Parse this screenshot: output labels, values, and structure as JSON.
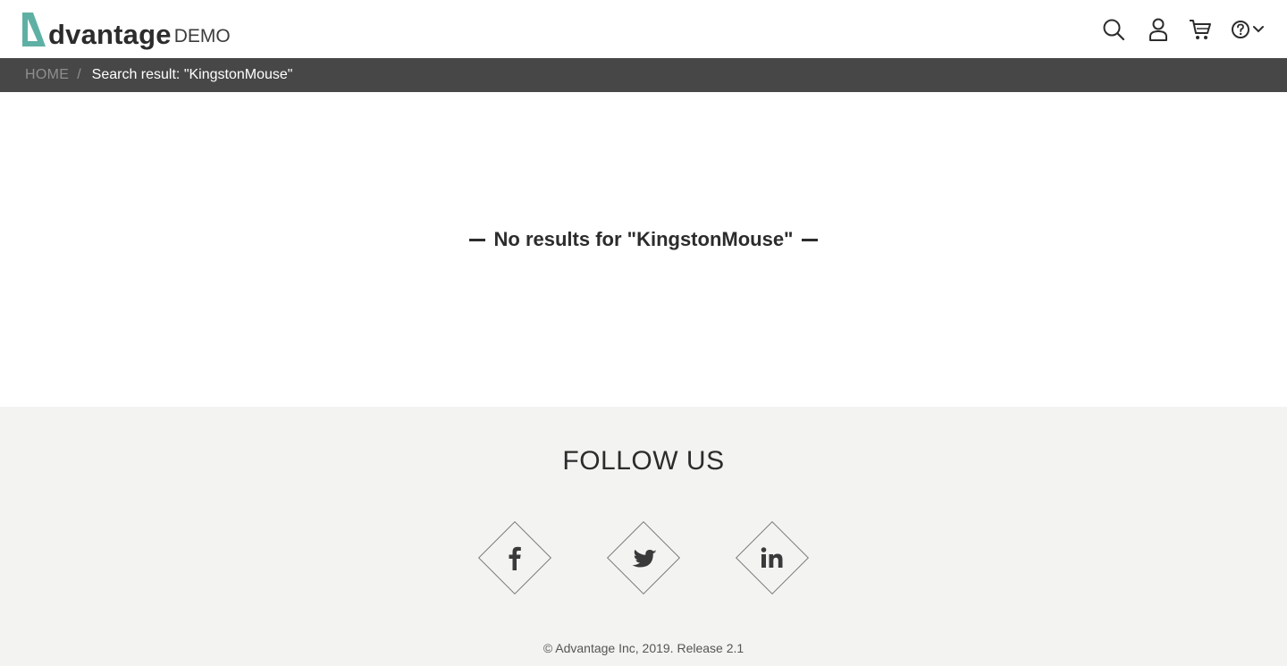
{
  "brand": {
    "name": "dvantage",
    "suffix": "DEMO",
    "accent": "#5fb0a4"
  },
  "header": {
    "icons": [
      "search-icon",
      "user-icon",
      "cart-icon",
      "help-icon",
      "chevron-down-icon"
    ]
  },
  "breadcrumb": {
    "home": "HOME",
    "separator": "/",
    "current": "Search result: \"KingstonMouse\""
  },
  "main": {
    "message": "No results for \"KingstonMouse\""
  },
  "footer": {
    "follow_title": "FOLLOW US",
    "social": [
      "facebook-icon",
      "twitter-icon",
      "linkedin-icon"
    ],
    "copyright": "© Advantage Inc, 2019. Release 2.1"
  },
  "colors": {
    "breadcrumb_bg": "#474747",
    "footer_bg": "#f3f3f1",
    "text": "#2c2c2c"
  }
}
